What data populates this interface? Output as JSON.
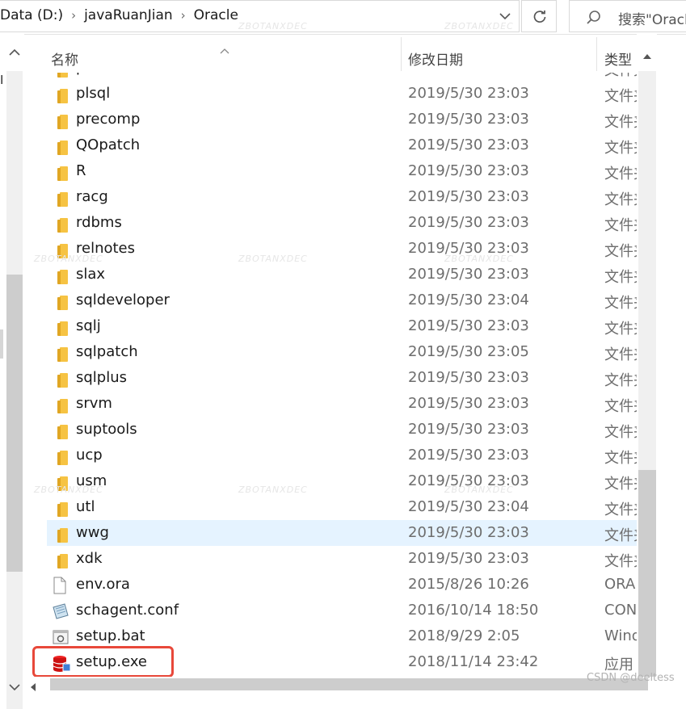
{
  "address": {
    "breadcrumbs": [
      "Data (D:)",
      "javaRuanJian",
      "Oracle"
    ],
    "separator": "›",
    "dropdown_icon": "chevron-down-icon",
    "refresh_icon": "refresh-icon"
  },
  "search": {
    "placeholder": "搜索\"Oracle\"",
    "icon": "search-icon"
  },
  "nav": {
    "partial_label": "I"
  },
  "columns": {
    "name": "名称",
    "date": "修改日期",
    "type": "类型"
  },
  "files": [
    {
      "name": "p",
      "date": "",
      "type": "文件夹",
      "icon": "folder-icon"
    },
    {
      "name": "plsql",
      "date": "2019/5/30 23:03",
      "type": "文件夹",
      "icon": "folder-icon"
    },
    {
      "name": "precomp",
      "date": "2019/5/30 23:03",
      "type": "文件夹",
      "icon": "folder-icon"
    },
    {
      "name": "QOpatch",
      "date": "2019/5/30 23:03",
      "type": "文件夹",
      "icon": "folder-icon"
    },
    {
      "name": "R",
      "date": "2019/5/30 23:03",
      "type": "文件夹",
      "icon": "folder-icon"
    },
    {
      "name": "racg",
      "date": "2019/5/30 23:03",
      "type": "文件夹",
      "icon": "folder-icon"
    },
    {
      "name": "rdbms",
      "date": "2019/5/30 23:03",
      "type": "文件夹",
      "icon": "folder-icon"
    },
    {
      "name": "relnotes",
      "date": "2019/5/30 23:03",
      "type": "文件夹",
      "icon": "folder-icon"
    },
    {
      "name": "slax",
      "date": "2019/5/30 23:03",
      "type": "文件夹",
      "icon": "folder-icon"
    },
    {
      "name": "sqldeveloper",
      "date": "2019/5/30 23:04",
      "type": "文件夹",
      "icon": "folder-icon"
    },
    {
      "name": "sqlj",
      "date": "2019/5/30 23:03",
      "type": "文件夹",
      "icon": "folder-icon"
    },
    {
      "name": "sqlpatch",
      "date": "2019/5/30 23:05",
      "type": "文件夹",
      "icon": "folder-icon"
    },
    {
      "name": "sqlplus",
      "date": "2019/5/30 23:03",
      "type": "文件夹",
      "icon": "folder-icon"
    },
    {
      "name": "srvm",
      "date": "2019/5/30 23:03",
      "type": "文件夹",
      "icon": "folder-icon"
    },
    {
      "name": "suptools",
      "date": "2019/5/30 23:03",
      "type": "文件夹",
      "icon": "folder-icon"
    },
    {
      "name": "ucp",
      "date": "2019/5/30 23:03",
      "type": "文件夹",
      "icon": "folder-icon"
    },
    {
      "name": "usm",
      "date": "2019/5/30 23:03",
      "type": "文件夹",
      "icon": "folder-icon"
    },
    {
      "name": "utl",
      "date": "2019/5/30 23:04",
      "type": "文件夹",
      "icon": "folder-icon"
    },
    {
      "name": "wwg",
      "date": "2019/5/30 23:03",
      "type": "文件夹",
      "icon": "folder-icon",
      "hover": true
    },
    {
      "name": "xdk",
      "date": "2019/5/30 23:03",
      "type": "文件夹",
      "icon": "folder-icon"
    },
    {
      "name": "env.ora",
      "date": "2015/8/26 10:26",
      "type": "ORA",
      "icon": "document-icon"
    },
    {
      "name": "schagent.conf",
      "date": "2016/10/14 18:50",
      "type": "CON",
      "icon": "config-file-icon"
    },
    {
      "name": "setup.bat",
      "date": "2018/9/29 2:05",
      "type": "Wind",
      "icon": "batch-file-icon"
    },
    {
      "name": "setup.exe",
      "date": "2018/11/14 23:42",
      "type": "应用",
      "icon": "database-setup-icon",
      "highlighted": true
    }
  ],
  "watermark": {
    "text": "ZBOTANXDEC",
    "credit": "CSDN @deeltess"
  },
  "colors": {
    "hover": "#e5f3ff",
    "highlight": "#e8483a",
    "folder": "#f6c343"
  }
}
